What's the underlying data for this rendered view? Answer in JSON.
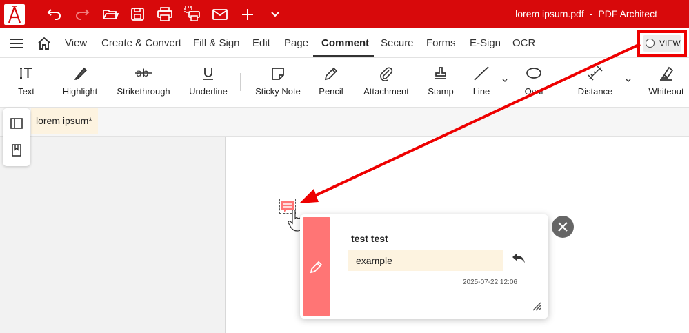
{
  "titlebar": {
    "file_name": "lorem ipsum.pdf",
    "separator": "-",
    "app_name": "PDF Architect",
    "accent_color": "#d8090b",
    "quick_access": [
      "undo-icon",
      "redo-icon",
      "open-folder-icon",
      "save-icon",
      "print-icon",
      "print-settings-icon",
      "email-icon",
      "plus-icon",
      "chevron-down-icon"
    ]
  },
  "menu": {
    "items": [
      "View",
      "Create & Convert",
      "Fill & Sign",
      "Edit",
      "Page",
      "Comment",
      "Secure",
      "Forms",
      "E-Sign",
      "OCR"
    ],
    "active": "Comment",
    "view_button_label": "VIEW"
  },
  "ribbon": {
    "tools": [
      "Text",
      "Highlight",
      "Strikethrough",
      "Underline",
      "Sticky Note",
      "Pencil",
      "Attachment",
      "Stamp",
      "Line",
      "Oval",
      "Distance",
      "Whiteout"
    ]
  },
  "document": {
    "tab_label": "lorem ipsum*"
  },
  "comment_popup": {
    "author": "test test",
    "comment": "example",
    "timestamp": "2025-07-22 12:06",
    "color": "#ff7575"
  }
}
